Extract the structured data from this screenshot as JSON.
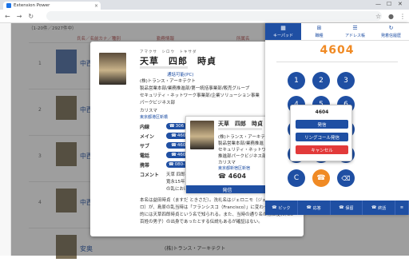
{
  "browser": {
    "tab_title": "Extension Power",
    "tab_close": "×",
    "min": "—",
    "max": "☐",
    "close": "✕",
    "back": "←",
    "forward": "→",
    "reload": "↻",
    "star": "☆",
    "account": "●",
    "menu": "⋮"
  },
  "page": {
    "count_text": "（1-20件／2927件中）",
    "col_name": "氏名／名前カナ／種別",
    "col_company": "勤務情報",
    "col_dept": "所属名",
    "rows": [
      {
        "num": "1",
        "name": "中西"
      },
      {
        "num": "2",
        "name": "中西"
      },
      {
        "num": "3",
        "name": "中西"
      },
      {
        "num": "4",
        "name": "中西"
      },
      {
        "num": "",
        "name": "安奥"
      }
    ],
    "footer_company": "(株)トランス・アーキテクト"
  },
  "card": {
    "ruby": "アマクサ　シロウ　トキサダ",
    "name": "天草　四郎　時貞",
    "status": "通話可能(PC)",
    "company": "(株)トランス・アーキテクト",
    "dept1": "製品営業本部/業務推進部/第一統括事業部/販売グループ",
    "dept2": "セキュリティ・ネットワーク事業部/企業ソリューション事業",
    "dept3": "パークビジネス部",
    "title": "カリスマ",
    "address": "東京都港区新橋",
    "labels": {
      "internal": "内線",
      "main": "メイン",
      "sub": "サブ",
      "phone": "電話",
      "mobile": "携帯",
      "comment": "コメント"
    },
    "numbers": {
      "internal": "306",
      "main": "4601",
      "sub": "4602",
      "phone": "4604",
      "mobile": "080-1234"
    },
    "comment1": "天草 四郎（あまくさ しろう",
    "comment2": "寛永15年2月28日（16",
    "comment3": "の乱における一揆軍の",
    "bio1": "本名は益田時貞（ますだ ときさだ）。洗礼名はジェロニモ（ジェロニモ、Geronimo）」であったが、一揆勃発時の洗礼名は",
    "bio2": "ロ）が、島原の乱当時は「フランシスコ（Francisco）」に変わっていた。一般",
    "bio3": "的には天草四郎時貞という名で知られる。また、当時の通り名の際に使われた",
    "bio4": "百姓の男子）の出身であったとする伝説もあるが確証はない。"
  },
  "card2": {
    "name": "天草　四郎　時貞",
    "company": "(株)トランス・アーキテクト",
    "dept1": "製品営業本部/業務推進",
    "dept2": "セキュリティ・ネットワーク",
    "dept3": "推進部パークビジネス部",
    "title": "カリスマ",
    "address": "東京都新宿区新宿",
    "number": "4604",
    "call_label": "発信"
  },
  "phone": {
    "tabs": [
      {
        "label": "キーパッド",
        "icon": "▦"
      },
      {
        "label": "職種",
        "icon": "⊞"
      },
      {
        "label": "アドレス帳",
        "icon": "☰"
      },
      {
        "label": "発着信履歴",
        "icon": "↻"
      }
    ],
    "number": "4604",
    "keys": [
      "1",
      "2",
      "3",
      "4",
      "5",
      "6",
      "7",
      "8",
      "9",
      "*",
      "0",
      "#",
      "C",
      "☎",
      "⌫"
    ],
    "bottom": [
      {
        "icon": "☎",
        "label": "ピック"
      },
      {
        "icon": "☎",
        "label": "応答"
      },
      {
        "icon": "☎",
        "label": "保留"
      },
      {
        "icon": "☎",
        "label": "終話"
      },
      {
        "icon": "≡",
        "label": ""
      }
    ]
  },
  "popup": {
    "number": "4604",
    "call": "発信",
    "ring": "リングコール発信",
    "cancel": "キャンセル"
  },
  "colors": {
    "accent": "#1f4fa3",
    "orange": "#f08a24",
    "danger": "#e23a3a"
  }
}
